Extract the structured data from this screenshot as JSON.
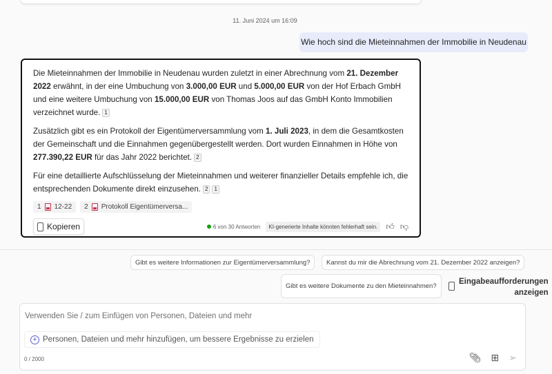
{
  "timestamp": "11. Juni 2024 um 16:09",
  "user_message": "Wie hoch sind die Mieteinnahmen der Immobilie in Neudenau",
  "response": {
    "p1": [
      "Die Mieteinnahmen der Immobilie in Neudenau wurden zuletzt in einer Abrechnung vom ",
      "21. Dezember 2022",
      " erwähnt, in der eine Umbuchung von ",
      "3.000,00 EUR",
      " und ",
      "5.000,00 EUR",
      " von der Hof Erbach GmbH und eine weitere Umbuchung von ",
      "15.000,00 EUR",
      " von Thomas Joos auf das GmbH Konto Immobilien verzeichnet wurde."
    ],
    "p1_cites": [
      "1"
    ],
    "p2": [
      "Zusätzlich gibt es ein Protokoll der Eigentümerversammlung vom ",
      "1. Juli 2023",
      ", in dem die Gesamtkosten der Gemeinschaft und die Einnahmen gegenübergestellt werden. Dort wurden Einnahmen in Höhe von ",
      "277.390,22 EUR",
      " für das Jahr 2022 berichtet."
    ],
    "p2_cites": [
      "2"
    ],
    "p3": "Für eine detaillierte Aufschlüsselung der Mieteinnahmen und weiterer finanzieller Details empfehle ich, die entsprechenden Dokumente direkt einzusehen.",
    "p3_cites": [
      "2",
      "1"
    ],
    "references": [
      {
        "num": "1",
        "label": "12-22"
      },
      {
        "num": "2",
        "label": "Protokoll Eigentümerversa..."
      }
    ],
    "copy_label": "Kopieren",
    "answer_count": "6 von 30 Antworten",
    "disclaimer": "KI-generierte Inhalte könnten fehlerhaft sein."
  },
  "suggestions": [
    "Gibt es weitere Informationen zur Eigentümerversammlung?",
    "Kannst du mir die Abrechnung vom 21. Dezember 2022 anzeigen?",
    "Gibt es weitere Dokumente zu den Mieteinnahmen?"
  ],
  "prompts_label_1": "Eingabeaufforderungen",
  "prompts_label_2": "anzeigen",
  "input": {
    "placeholder": "Verwenden Sie / zum Einfügen von Personen, Dateien und mehr",
    "add_hint": "Personen, Dateien und mehr hinzufügen, um bessere Ergebnisse zu erzielen",
    "char_count": "0 / 2000"
  },
  "colors": {
    "accent": "#5b5fc7",
    "user_bubble": "#e8ebfa",
    "status": "#13a10e"
  }
}
